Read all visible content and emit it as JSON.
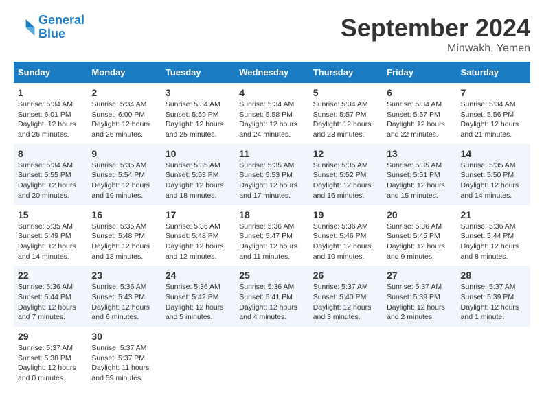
{
  "header": {
    "logo_line1": "General",
    "logo_line2": "Blue",
    "month": "September 2024",
    "location": "Minwakh, Yemen"
  },
  "weekdays": [
    "Sunday",
    "Monday",
    "Tuesday",
    "Wednesday",
    "Thursday",
    "Friday",
    "Saturday"
  ],
  "weeks": [
    [
      {
        "day": "1",
        "info": "Sunrise: 5:34 AM\nSunset: 6:01 PM\nDaylight: 12 hours\nand 26 minutes."
      },
      {
        "day": "2",
        "info": "Sunrise: 5:34 AM\nSunset: 6:00 PM\nDaylight: 12 hours\nand 26 minutes."
      },
      {
        "day": "3",
        "info": "Sunrise: 5:34 AM\nSunset: 5:59 PM\nDaylight: 12 hours\nand 25 minutes."
      },
      {
        "day": "4",
        "info": "Sunrise: 5:34 AM\nSunset: 5:58 PM\nDaylight: 12 hours\nand 24 minutes."
      },
      {
        "day": "5",
        "info": "Sunrise: 5:34 AM\nSunset: 5:57 PM\nDaylight: 12 hours\nand 23 minutes."
      },
      {
        "day": "6",
        "info": "Sunrise: 5:34 AM\nSunset: 5:57 PM\nDaylight: 12 hours\nand 22 minutes."
      },
      {
        "day": "7",
        "info": "Sunrise: 5:34 AM\nSunset: 5:56 PM\nDaylight: 12 hours\nand 21 minutes."
      }
    ],
    [
      {
        "day": "8",
        "info": "Sunrise: 5:34 AM\nSunset: 5:55 PM\nDaylight: 12 hours\nand 20 minutes."
      },
      {
        "day": "9",
        "info": "Sunrise: 5:35 AM\nSunset: 5:54 PM\nDaylight: 12 hours\nand 19 minutes."
      },
      {
        "day": "10",
        "info": "Sunrise: 5:35 AM\nSunset: 5:53 PM\nDaylight: 12 hours\nand 18 minutes."
      },
      {
        "day": "11",
        "info": "Sunrise: 5:35 AM\nSunset: 5:53 PM\nDaylight: 12 hours\nand 17 minutes."
      },
      {
        "day": "12",
        "info": "Sunrise: 5:35 AM\nSunset: 5:52 PM\nDaylight: 12 hours\nand 16 minutes."
      },
      {
        "day": "13",
        "info": "Sunrise: 5:35 AM\nSunset: 5:51 PM\nDaylight: 12 hours\nand 15 minutes."
      },
      {
        "day": "14",
        "info": "Sunrise: 5:35 AM\nSunset: 5:50 PM\nDaylight: 12 hours\nand 14 minutes."
      }
    ],
    [
      {
        "day": "15",
        "info": "Sunrise: 5:35 AM\nSunset: 5:49 PM\nDaylight: 12 hours\nand 14 minutes."
      },
      {
        "day": "16",
        "info": "Sunrise: 5:35 AM\nSunset: 5:48 PM\nDaylight: 12 hours\nand 13 minutes."
      },
      {
        "day": "17",
        "info": "Sunrise: 5:36 AM\nSunset: 5:48 PM\nDaylight: 12 hours\nand 12 minutes."
      },
      {
        "day": "18",
        "info": "Sunrise: 5:36 AM\nSunset: 5:47 PM\nDaylight: 12 hours\nand 11 minutes."
      },
      {
        "day": "19",
        "info": "Sunrise: 5:36 AM\nSunset: 5:46 PM\nDaylight: 12 hours\nand 10 minutes."
      },
      {
        "day": "20",
        "info": "Sunrise: 5:36 AM\nSunset: 5:45 PM\nDaylight: 12 hours\nand 9 minutes."
      },
      {
        "day": "21",
        "info": "Sunrise: 5:36 AM\nSunset: 5:44 PM\nDaylight: 12 hours\nand 8 minutes."
      }
    ],
    [
      {
        "day": "22",
        "info": "Sunrise: 5:36 AM\nSunset: 5:44 PM\nDaylight: 12 hours\nand 7 minutes."
      },
      {
        "day": "23",
        "info": "Sunrise: 5:36 AM\nSunset: 5:43 PM\nDaylight: 12 hours\nand 6 minutes."
      },
      {
        "day": "24",
        "info": "Sunrise: 5:36 AM\nSunset: 5:42 PM\nDaylight: 12 hours\nand 5 minutes."
      },
      {
        "day": "25",
        "info": "Sunrise: 5:36 AM\nSunset: 5:41 PM\nDaylight: 12 hours\nand 4 minutes."
      },
      {
        "day": "26",
        "info": "Sunrise: 5:37 AM\nSunset: 5:40 PM\nDaylight: 12 hours\nand 3 minutes."
      },
      {
        "day": "27",
        "info": "Sunrise: 5:37 AM\nSunset: 5:39 PM\nDaylight: 12 hours\nand 2 minutes."
      },
      {
        "day": "28",
        "info": "Sunrise: 5:37 AM\nSunset: 5:39 PM\nDaylight: 12 hours\nand 1 minute."
      }
    ],
    [
      {
        "day": "29",
        "info": "Sunrise: 5:37 AM\nSunset: 5:38 PM\nDaylight: 12 hours\nand 0 minutes."
      },
      {
        "day": "30",
        "info": "Sunrise: 5:37 AM\nSunset: 5:37 PM\nDaylight: 11 hours\nand 59 minutes."
      },
      {
        "day": "",
        "info": ""
      },
      {
        "day": "",
        "info": ""
      },
      {
        "day": "",
        "info": ""
      },
      {
        "day": "",
        "info": ""
      },
      {
        "day": "",
        "info": ""
      }
    ]
  ]
}
